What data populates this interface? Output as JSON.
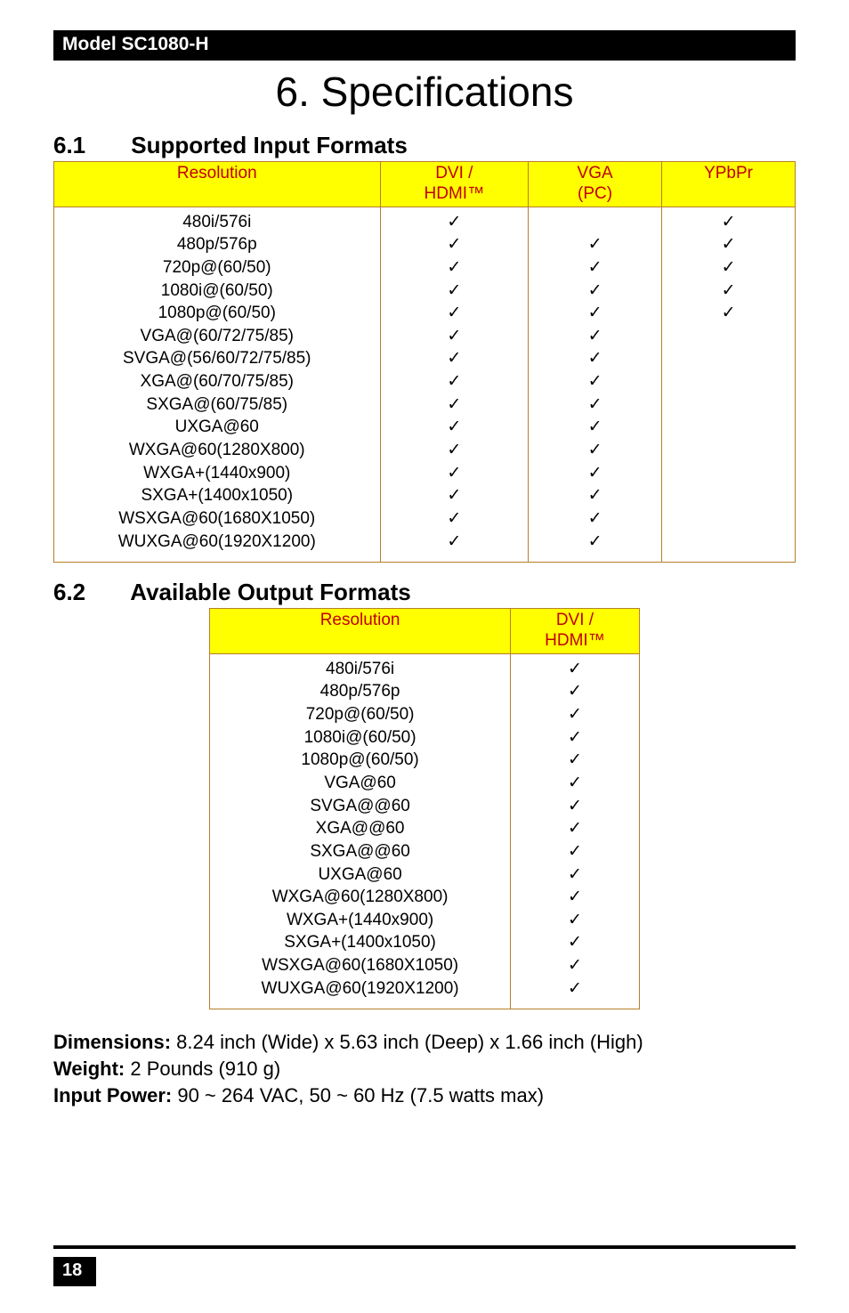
{
  "model_bar": "Model SC1080-H",
  "chapter_title": "6. Specifications",
  "section1": {
    "num": "6.1",
    "title": "Supported Input Formats"
  },
  "section2": {
    "num": "6.2",
    "title": "Available Output Formats"
  },
  "chart_data": [
    {
      "type": "table",
      "title": "Supported Input Formats",
      "columns": [
        "Resolution",
        "DVI / HDMI™",
        "VGA (PC)",
        "YPbPr"
      ],
      "rows": [
        {
          "res": "480i/576i",
          "dvi": true,
          "vga": false,
          "ypbpr": true
        },
        {
          "res": "480p/576p",
          "dvi": true,
          "vga": true,
          "ypbpr": true
        },
        {
          "res": "720p@(60/50)",
          "dvi": true,
          "vga": true,
          "ypbpr": true
        },
        {
          "res": "1080i@(60/50)",
          "dvi": true,
          "vga": true,
          "ypbpr": true
        },
        {
          "res": "1080p@(60/50)",
          "dvi": true,
          "vga": true,
          "ypbpr": true
        },
        {
          "res": "VGA@(60/72/75/85)",
          "dvi": true,
          "vga": true,
          "ypbpr": false
        },
        {
          "res": "SVGA@(56/60/72/75/85)",
          "dvi": true,
          "vga": true,
          "ypbpr": false
        },
        {
          "res": "XGA@(60/70/75/85)",
          "dvi": true,
          "vga": true,
          "ypbpr": false
        },
        {
          "res": "SXGA@(60/75/85)",
          "dvi": true,
          "vga": true,
          "ypbpr": false
        },
        {
          "res": "UXGA@60",
          "dvi": true,
          "vga": true,
          "ypbpr": false
        },
        {
          "res": "WXGA@60(1280X800)",
          "dvi": true,
          "vga": true,
          "ypbpr": false
        },
        {
          "res": "WXGA+(1440x900)",
          "dvi": true,
          "vga": true,
          "ypbpr": false
        },
        {
          "res": "SXGA+(1400x1050)",
          "dvi": true,
          "vga": true,
          "ypbpr": false
        },
        {
          "res": "WSXGA@60(1680X1050)",
          "dvi": true,
          "vga": true,
          "ypbpr": false
        },
        {
          "res": "WUXGA@60(1920X1200)",
          "dvi": true,
          "vga": true,
          "ypbpr": false
        }
      ]
    },
    {
      "type": "table",
      "title": "Available Output Formats",
      "columns": [
        "Resolution",
        "DVI / HDMI™"
      ],
      "rows": [
        {
          "res": "480i/576i",
          "dvi": true
        },
        {
          "res": "480p/576p",
          "dvi": true
        },
        {
          "res": "720p@(60/50)",
          "dvi": true
        },
        {
          "res": "1080i@(60/50)",
          "dvi": true
        },
        {
          "res": "1080p@(60/50)",
          "dvi": true
        },
        {
          "res": "VGA@60",
          "dvi": true
        },
        {
          "res": "SVGA@@60",
          "dvi": true
        },
        {
          "res": "XGA@@60",
          "dvi": true
        },
        {
          "res": "SXGA@@60",
          "dvi": true
        },
        {
          "res": "UXGA@60",
          "dvi": true
        },
        {
          "res": "WXGA@60(1280X800)",
          "dvi": true
        },
        {
          "res": "WXGA+(1440x900)",
          "dvi": true
        },
        {
          "res": "SXGA+(1400x1050)",
          "dvi": true
        },
        {
          "res": "WSXGA@60(1680X1050)",
          "dvi": true
        },
        {
          "res": "WUXGA@60(1920X1200)",
          "dvi": true
        }
      ]
    }
  ],
  "input_headers": {
    "res": "Resolution",
    "dvi_line1": "DVI /",
    "dvi_line2": "HDMI™",
    "vga_line1": "VGA",
    "vga_line2": "(PC)",
    "ypbpr": "YPbPr"
  },
  "output_headers": {
    "res": "Resolution",
    "dvi_line1": "DVI /",
    "dvi_line2": "HDMI™"
  },
  "body": {
    "dimensions_label": "Dimensions:",
    "dimensions_value": " 8.24 inch (Wide) x 5.63 inch (Deep) x 1.66 inch (High)",
    "weight_label": "Weight:",
    "weight_value": " 2 Pounds (910 g)",
    "power_label": "Input Power:",
    "power_value": " 90 ~ 264 VAC, 50 ~ 60 Hz (7.5 watts max)"
  },
  "page_number": "18",
  "check_glyph": "✓"
}
